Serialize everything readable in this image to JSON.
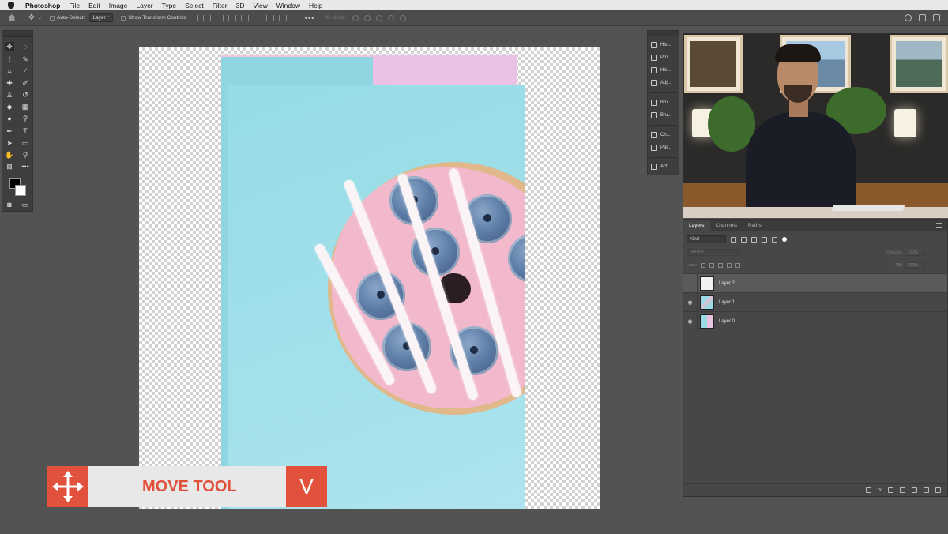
{
  "menubar": {
    "app": "Photoshop",
    "items": [
      "File",
      "Edit",
      "Image",
      "Layer",
      "Type",
      "Select",
      "Filter",
      "3D",
      "View",
      "Window",
      "Help"
    ]
  },
  "options": {
    "auto_select_label": "Auto-Select:",
    "auto_select_value": "Layer",
    "transform_label": "Show Transform Controls",
    "more": "•••",
    "mode_3d": "3D Mode:"
  },
  "dock": {
    "items": [
      "His...",
      "Pro...",
      "His...",
      "Adj...",
      "Bru...",
      "Bru...",
      "Ch...",
      "Par...",
      "Act..."
    ]
  },
  "layers_panel": {
    "tabs": [
      "Layers",
      "Channels",
      "Paths"
    ],
    "kind": "Kind",
    "blend_mode": "Normal",
    "opacity_label": "Opacity:",
    "opacity_value": "100%",
    "lock_label": "Lock:",
    "fill_label": "Fill:",
    "fill_value": "100%",
    "layers": [
      {
        "name": "Layer 2",
        "visible": false,
        "selected": true
      },
      {
        "name": "Layer 1",
        "visible": true,
        "selected": false
      },
      {
        "name": "Layer 0",
        "visible": true,
        "selected": false
      }
    ],
    "footer_fx": "fx"
  },
  "lower_third": {
    "label": "MOVE TOOL",
    "key": "V"
  },
  "colors": {
    "accent": "#e2513c",
    "canvas_blue": "#a3e0ea",
    "canvas_pink": "#ecc1e6"
  }
}
